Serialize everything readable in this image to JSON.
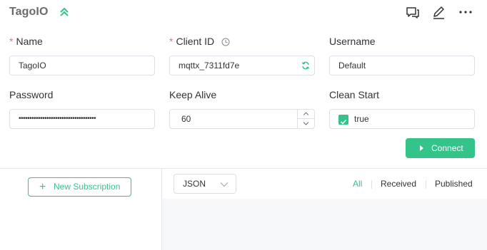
{
  "header": {
    "title": "TagoIO"
  },
  "form": {
    "name": {
      "label": "Name",
      "required": "*",
      "value": "TagoIO"
    },
    "client_id": {
      "label": "Client ID",
      "required": "*",
      "value": "mqttx_7311fd7e"
    },
    "username": {
      "label": "Username",
      "value": "Default"
    },
    "password": {
      "label": "Password",
      "value": "••••••••••••••••••••••••••••••••••••"
    },
    "keep_alive": {
      "label": "Keep Alive",
      "value": "60"
    },
    "clean_start": {
      "label": "Clean Start",
      "value": "true",
      "checked": true
    }
  },
  "connect_button": {
    "label": "Connect"
  },
  "subscriptions": {
    "new_button": "New Subscription"
  },
  "messages": {
    "format": "JSON",
    "filters": [
      "All",
      "Received",
      "Published"
    ],
    "active_filter": "All"
  },
  "colors": {
    "accent": "#34c388",
    "required": "#f56c6c"
  },
  "icons": [
    "collapse-up-icon",
    "chat-icon",
    "edit-icon",
    "more-icon",
    "clock-icon",
    "refresh-icon",
    "chevron-down-icon"
  ]
}
